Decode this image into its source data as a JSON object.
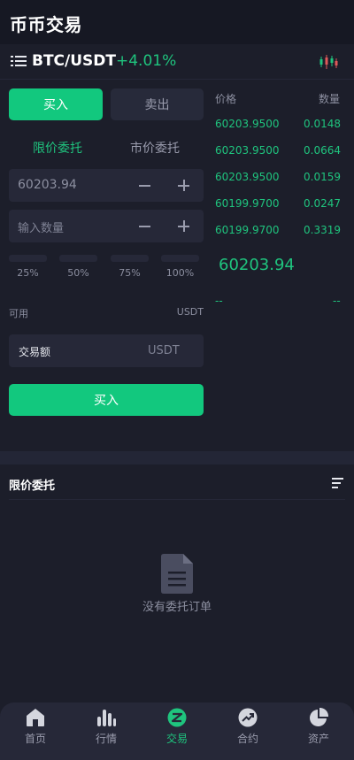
{
  "header": {
    "title": "币币交易"
  },
  "pair": {
    "name": "BTC/USDT",
    "change": "+4.01%"
  },
  "trade": {
    "buy_tab": "买入",
    "sell_tab": "卖出",
    "limit_tab": "限价委托",
    "market_tab": "市价委托",
    "price_value": "60203.94",
    "qty_placeholder": "输入数量",
    "percents": [
      "25%",
      "50%",
      "75%",
      "100%"
    ],
    "available_label": "可用",
    "available_unit": "USDT",
    "amount_label": "交易额",
    "amount_unit": "USDT",
    "submit_label": "买入"
  },
  "orderbook": {
    "price_header": "价格",
    "qty_header": "数量",
    "rows": [
      {
        "price": "60203.9500",
        "qty": "0.0148"
      },
      {
        "price": "60203.9500",
        "qty": "0.0664"
      },
      {
        "price": "60203.9500",
        "qty": "0.0159"
      },
      {
        "price": "60199.9700",
        "qty": "0.0247"
      },
      {
        "price": "60199.9700",
        "qty": "0.3319"
      }
    ],
    "last_price": "60203.94",
    "bid_left": "--",
    "bid_right": "--"
  },
  "orders": {
    "title": "限价委托",
    "empty_text": "没有委托订单"
  },
  "nav": {
    "items": [
      {
        "label": "首页",
        "icon": "home-icon"
      },
      {
        "label": "行情",
        "icon": "market-icon"
      },
      {
        "label": "交易",
        "icon": "trade-icon"
      },
      {
        "label": "合约",
        "icon": "contract-icon"
      },
      {
        "label": "资产",
        "icon": "assets-icon"
      }
    ],
    "active": "交易"
  },
  "colors": {
    "accent": "#12c87e",
    "up": "#1fc47e",
    "background": "#1c1e2a",
    "panel": "#262838"
  }
}
